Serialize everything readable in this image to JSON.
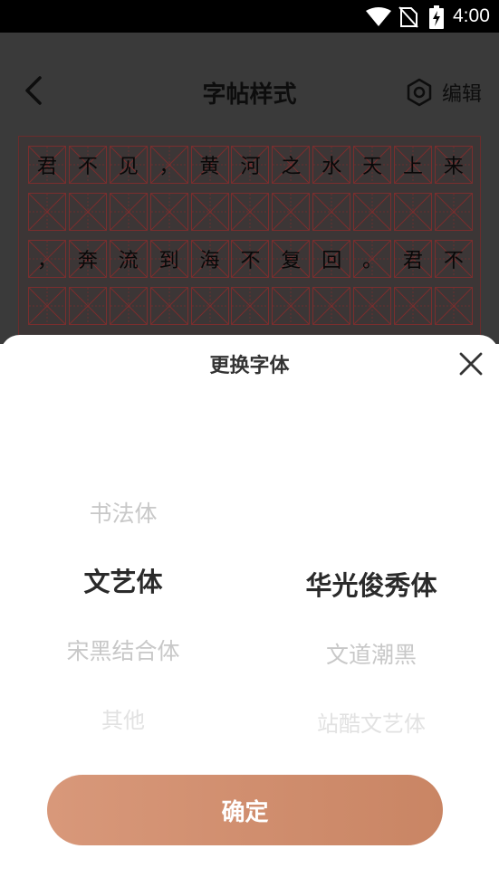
{
  "status_bar": {
    "time": "4:00",
    "icons": [
      "wifi-icon",
      "no-sim-icon",
      "battery-charging-icon"
    ]
  },
  "header": {
    "title": "字帖样式",
    "back_icon": "chevron-left-icon",
    "edit_label": "编辑",
    "edit_icon": "hexagon-gear-icon"
  },
  "copybook": {
    "rows": [
      [
        "君",
        "不",
        "见",
        "，",
        "黄",
        "河",
        "之",
        "水",
        "天",
        "上",
        "来"
      ],
      [
        "",
        "",
        "",
        "",
        "",
        "",
        "",
        "",
        "",
        "",
        ""
      ],
      [
        "，",
        "奔",
        "流",
        "到",
        "海",
        "不",
        "复",
        "回",
        "。",
        "君",
        "不"
      ],
      [
        "",
        "",
        "",
        "",
        "",
        "",
        "",
        "",
        "",
        "",
        ""
      ]
    ]
  },
  "sheet": {
    "title": "更换字体",
    "close_icon": "close-icon",
    "left_column": {
      "items": [
        "书法体",
        "文艺体",
        "宋黑结合体",
        "其他"
      ],
      "selected": "文艺体"
    },
    "right_column": {
      "items": [
        "华光俊秀体",
        "文道潮黑",
        "站酷文艺体"
      ],
      "selected": "华光俊秀体"
    },
    "confirm_label": "确定"
  },
  "colors": {
    "accent_start": "#d8987a",
    "accent_end": "#c98564",
    "overlay": "#3a3a3a",
    "grid_line": "#7a2e2e"
  }
}
